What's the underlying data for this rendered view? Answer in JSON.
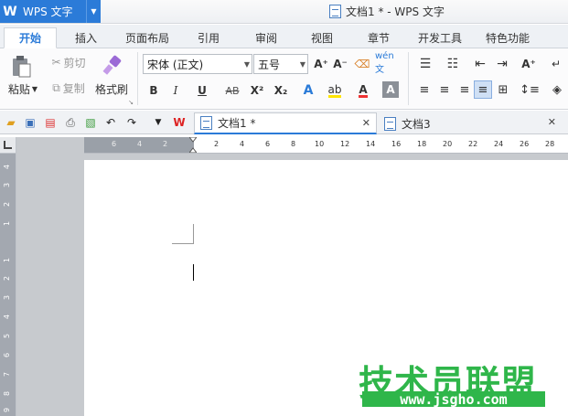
{
  "app": {
    "name": "WPS 文字",
    "logo_letter": "W",
    "window_title": "文档1 * - WPS 文字"
  },
  "menu_tabs": [
    "开始",
    "插入",
    "页面布局",
    "引用",
    "审阅",
    "视图",
    "章节",
    "开发工具",
    "特色功能"
  ],
  "ribbon": {
    "clipboard": {
      "paste": "粘贴",
      "cut": "剪切",
      "copy": "复制",
      "format_painter": "格式刷"
    },
    "font": {
      "name": "宋体 (正文)",
      "size": "五号",
      "grow": "A⁺",
      "shrink": "A⁻",
      "bold": "B",
      "italic": "I",
      "underline": "U",
      "strike": "AB",
      "superscript": "X²",
      "subscript": "X₂",
      "wen": "wén 文"
    }
  },
  "documents": {
    "tabs": [
      {
        "title": "文档1 *",
        "active": true
      },
      {
        "title": "文档3",
        "active": false
      }
    ]
  },
  "ruler": {
    "horizontal_labels": [
      "6",
      "4",
      "2",
      "2",
      "4",
      "6",
      "8",
      "10",
      "12",
      "14",
      "16",
      "18",
      "20",
      "22",
      "24",
      "26",
      "28"
    ],
    "vertical_labels": [
      "4",
      "3",
      "2",
      "1",
      "1",
      "2",
      "3",
      "4",
      "5",
      "6",
      "7",
      "8",
      "9"
    ]
  },
  "watermark": {
    "text": "技术员联盟",
    "url": "www.jsgho.com"
  },
  "colors": {
    "accent": "#2b7bd8",
    "watermark": "#2fb64a",
    "desk": "#c7cace"
  }
}
